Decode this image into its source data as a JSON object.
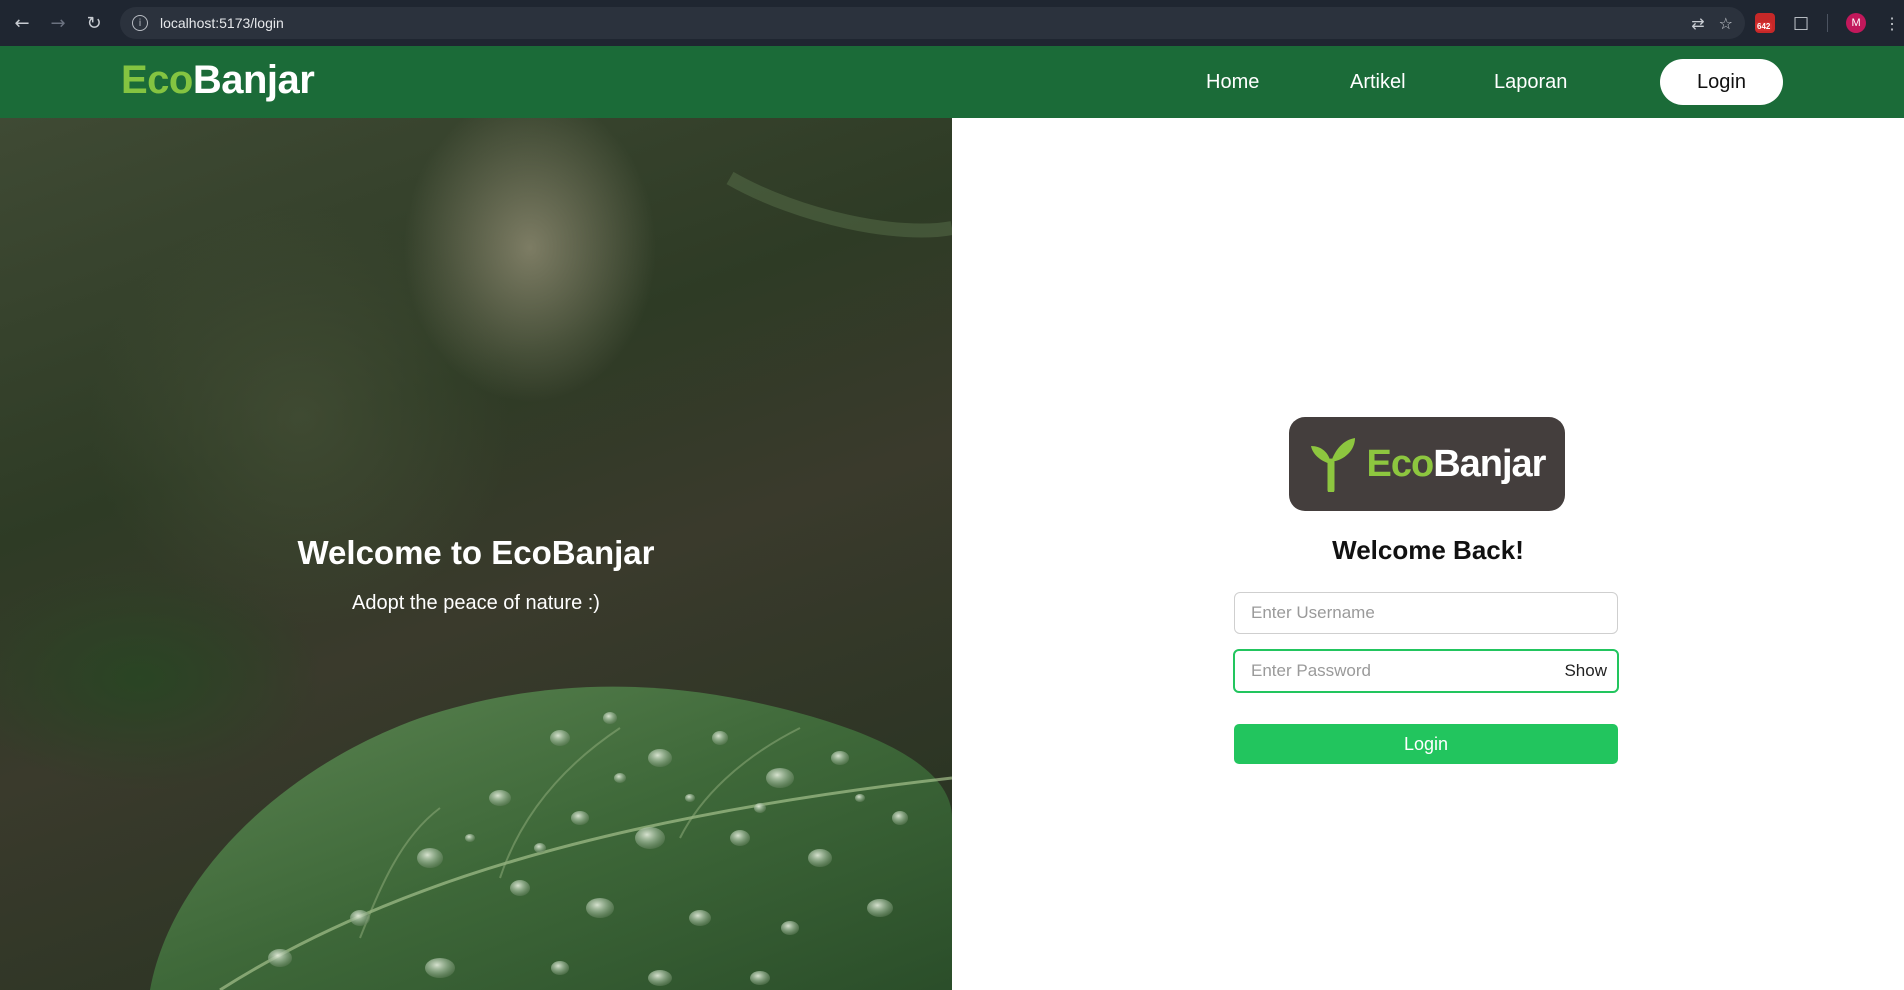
{
  "browser": {
    "url": "localhost:5173/login",
    "extension_badge": "642",
    "profile_initial": "M"
  },
  "header": {
    "brand_eco": "Eco",
    "brand_banjar": "Banjar",
    "nav": [
      {
        "label": "Home"
      },
      {
        "label": "Artikel"
      },
      {
        "label": "Laporan"
      }
    ],
    "login_label": "Login"
  },
  "hero": {
    "title": "Welcome to EcoBanjar",
    "subtitle": "Adopt the peace of nature :)"
  },
  "login": {
    "logo_eco": "Eco",
    "logo_banjar": "Banjar",
    "heading": "Welcome Back!",
    "username_placeholder": "Enter Username",
    "username_value": "",
    "password_placeholder": "Enter Password",
    "password_value": "",
    "show_label": "Show",
    "submit_label": "Login"
  },
  "colors": {
    "header_bg": "#1b6b38",
    "brand_green": "#84c441",
    "button_green": "#22c55e",
    "logo_bg": "#443e3d"
  },
  "icons": [
    "back-arrow-icon",
    "forward-arrow-icon",
    "reload-icon",
    "site-info-icon",
    "translate-icon",
    "bookmark-star-icon",
    "extension-icon",
    "puzzle-icon",
    "profile-avatar-icon",
    "kebab-menu-icon",
    "sprout-icon"
  ]
}
